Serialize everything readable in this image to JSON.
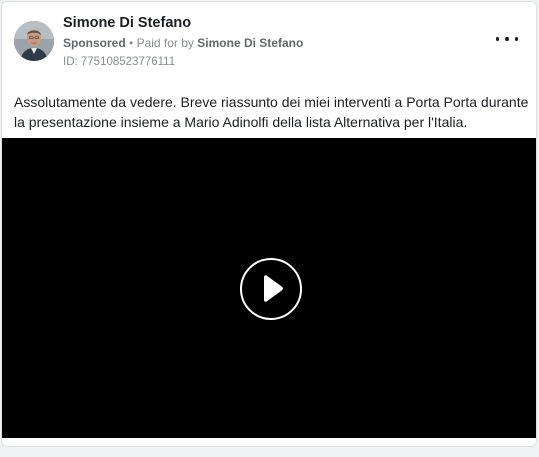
{
  "post": {
    "author_name": "Simone Di Stefano",
    "sponsored_label": "Sponsored",
    "separator": "•",
    "paid_for_label": "Paid for by",
    "paid_for_name": "Simone Di Stefano",
    "ad_id": "ID: 775108523776111",
    "body_text": "Assolutamente da vedere. Breve riassunto dei miei interventi a Porta Porta durante la presentazione insieme a Mario Adinolfi della lista Alternativa per l'Italia."
  },
  "icons": {
    "more": "more-options-icon",
    "play": "play-icon"
  },
  "colors": {
    "name_text": "#1c1e21",
    "secondary_text": "#8a8d91",
    "video_background": "#000000",
    "card_background": "#ffffff"
  }
}
